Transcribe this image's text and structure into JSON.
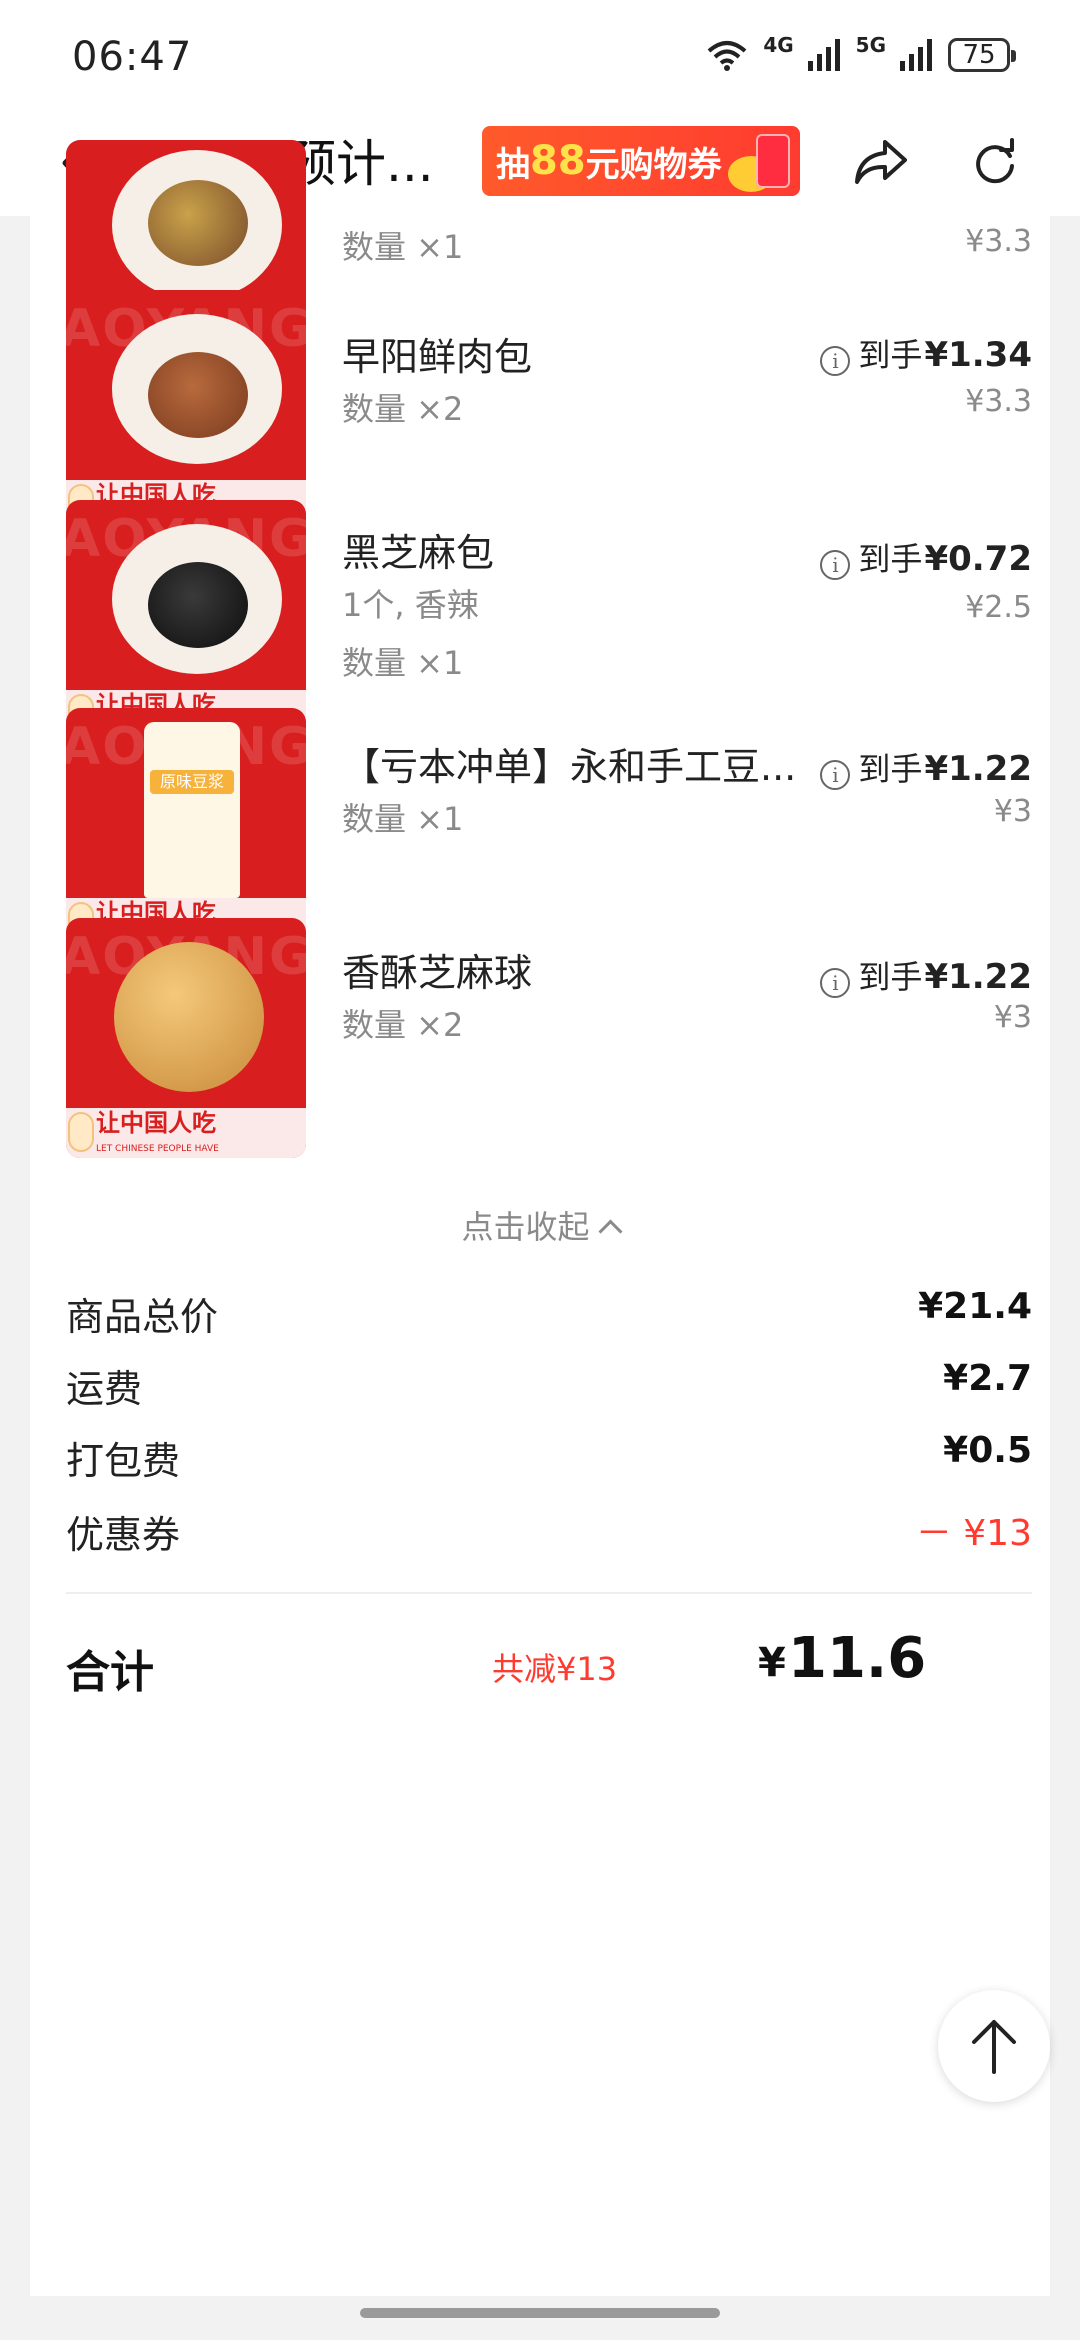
{
  "status_bar": {
    "time": "06:47",
    "battery": "75",
    "net_a": "4G",
    "net_b": "5G"
  },
  "nav": {
    "title": "07:20 预计...",
    "promo": {
      "prefix": "抽",
      "amount": "88",
      "suffix": "元购物券"
    }
  },
  "product_image": {
    "banner": "让中国人吃",
    "banner_sub": "LET CHINESE PEOPLE HAVE",
    "brand": "AOYANG"
  },
  "items": [
    {
      "name": "",
      "spec": "",
      "qty": "数量 ×1",
      "final_label": "",
      "final_price": "",
      "orig_price": "¥3.3"
    },
    {
      "name": "早阳鲜肉包",
      "spec": "",
      "qty": "数量 ×2",
      "final_label": "到手",
      "final_price": "1.34",
      "orig_price": "¥3.3"
    },
    {
      "name": "黑芝麻包",
      "spec": "1个, 香辣",
      "qty": "数量 ×1",
      "final_label": "到手",
      "final_price": "0.72",
      "orig_price": "¥2.5"
    },
    {
      "name": "【亏本冲单】永和手工豆...",
      "spec": "",
      "qty": "数量 ×1",
      "final_label": "到手",
      "final_price": "1.22",
      "orig_price": "¥3",
      "pack_label": "原味豆浆"
    },
    {
      "name": "香酥芝麻球",
      "spec": "",
      "qty": "数量 ×2",
      "final_label": "到手",
      "final_price": "1.22",
      "orig_price": "¥3"
    }
  ],
  "currency": "¥",
  "collapse_label": "点击收起",
  "summary": [
    {
      "label": "商品总价",
      "value": "¥21.4"
    },
    {
      "label": "运费",
      "value": "¥2.7"
    },
    {
      "label": "打包费",
      "value": "¥0.5"
    },
    {
      "label": "优惠券",
      "value": "－ ¥13"
    }
  ],
  "total": {
    "label": "合计",
    "saved": "共减¥13",
    "amount": "11.6"
  },
  "colors": {
    "accent_red": "#ff3b30",
    "thumb_red": "#d81e1e"
  }
}
